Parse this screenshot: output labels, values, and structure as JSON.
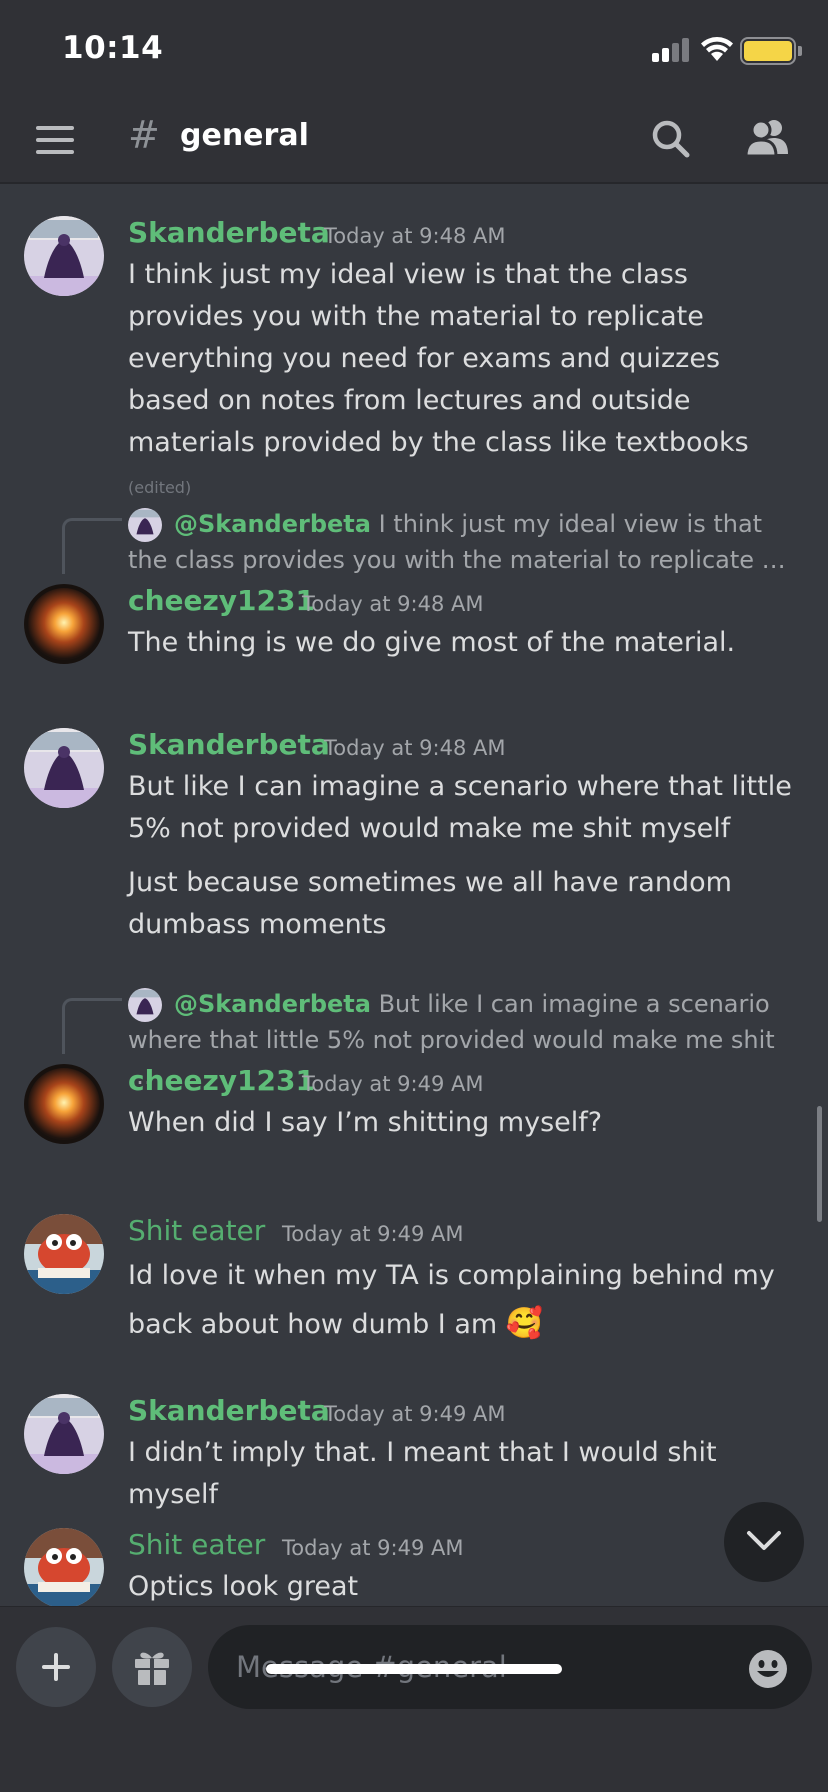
{
  "status_bar": {
    "time": "10:14"
  },
  "header": {
    "channel_name": "general"
  },
  "colors": {
    "background": "#36393f",
    "header": "#303136",
    "username_green": "#5fbd79",
    "text": "#dcddde",
    "muted": "#a3a6aa",
    "battery": "#f5d547"
  },
  "messages": [
    {
      "author": "Skanderbeta",
      "time": "Today at 9:48 AM",
      "text": "I think just my ideal view is that the class provides you with the material to replicate everything you need for exams and quizzes based on notes from lectures and outside materials provided by the class like textbooks",
      "edited": "(edited)",
      "avatar": "purple-figure-avatar"
    },
    {
      "reply_to": "@Skanderbeta",
      "reply_text": "I think just my ideal view is that the class provides you with the material to replicate …",
      "author": "cheezy1231",
      "time": "Today at 9:48 AM",
      "text": "The thing is we do give most of the material.",
      "avatar": "glowing-orb-avatar"
    },
    {
      "author": "Skanderbeta",
      "time": "Today at 9:48 AM",
      "text": "But like I can imagine a scenario where that little 5% not provided would make me shit myself",
      "text2": "Just because sometimes we all have random dumbass moments",
      "avatar": "purple-figure-avatar"
    },
    {
      "reply_to": "@Skanderbeta",
      "reply_text": "But like I can imagine a scenario where that little 5% not provided would make me shit …",
      "author": "cheezy1231",
      "time": "Today at 9:49 AM",
      "text": "When did I say I’m shitting myself?",
      "avatar": "glowing-orb-avatar"
    },
    {
      "author": "Shit eater",
      "time": "Today at 9:49 AM",
      "text": "Id love it when my TA is complaining behind my back about how dumb I am",
      "emoji": "🥰",
      "avatar": "crab-cartoon-avatar"
    },
    {
      "author": "Skanderbeta",
      "time": "Today at 9:49 AM",
      "text": "I didn’t imply that. I meant that I would shit myself",
      "avatar": "purple-figure-avatar"
    },
    {
      "author": "Shit eater",
      "time": "Today at 9:49 AM",
      "text": "Optics look great",
      "avatar": "crab-cartoon-avatar"
    }
  ],
  "composer": {
    "placeholder": "Message #general"
  }
}
